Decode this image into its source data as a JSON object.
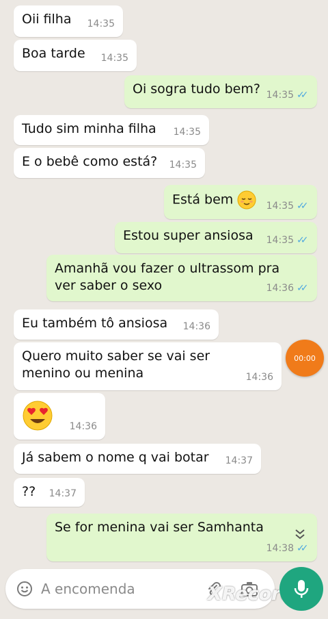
{
  "colors": {
    "background": "#ece8e3",
    "incoming_bubble": "#ffffff",
    "outgoing_bubble": "#e1f7cd",
    "read_ticks": "#4fa8e0",
    "mic_button": "#1fa67f",
    "recorder_badge": "#f07b1a"
  },
  "messages": [
    {
      "direction": "in",
      "text": "Oii filha",
      "time": "14:35"
    },
    {
      "direction": "in",
      "text": "Boa tarde",
      "time": "14:35"
    },
    {
      "direction": "out",
      "text": "Oi sogra tudo bem?",
      "time": "14:35",
      "status": "read"
    },
    {
      "direction": "in",
      "text": "Tudo sim minha filha",
      "time": "14:35"
    },
    {
      "direction": "in",
      "text": "E o bebê como está?",
      "time": "14:35"
    },
    {
      "direction": "out",
      "text": "Está bem",
      "emoji": "relieved-face",
      "time": "14:35",
      "status": "read"
    },
    {
      "direction": "out",
      "text": "Estou super ansiosa",
      "time": "14:35",
      "status": "read"
    },
    {
      "direction": "out",
      "text": "Amanhã vou fazer o ultrassom pra ver saber o sexo",
      "time": "14:36",
      "status": "read"
    },
    {
      "direction": "in",
      "text": "Eu também tô ansiosa",
      "time": "14:36"
    },
    {
      "direction": "in",
      "text": "Quero muito saber se vai ser menino ou menina",
      "time": "14:36"
    },
    {
      "direction": "in",
      "text": "",
      "emoji": "heart-eyes-face",
      "time": "14:36"
    },
    {
      "direction": "in",
      "text": "Já sabem o nome q vai botar",
      "time": "14:37"
    },
    {
      "direction": "in",
      "text": "??",
      "time": "14:37"
    },
    {
      "direction": "out",
      "text": "Se for menina vai ser  Samhanta",
      "time": "14:38",
      "status": "read"
    }
  ],
  "recorder_badge": {
    "text": "00:00"
  },
  "scroll_down": {
    "icon": "double-chevron-down-icon"
  },
  "input": {
    "placeholder": "A encomenda",
    "icons": [
      "emoji-icon",
      "attach-icon",
      "camera-icon"
    ]
  },
  "mic_button": {
    "icon": "mic-icon"
  },
  "watermark": {
    "text": "XRecorder"
  }
}
